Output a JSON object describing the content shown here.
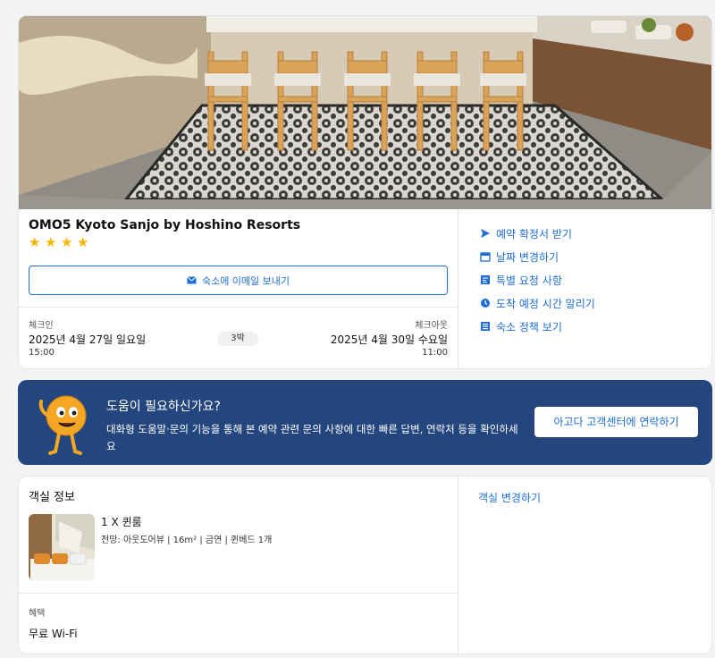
{
  "hotel": {
    "name": "OMO5 Kyoto Sanjo by Hoshino Resorts",
    "rating_stars": 4,
    "email_button": "숙소에 이메일 보내기",
    "checkin": {
      "label": "체크인",
      "date": "2025년 4월 27일 일요일",
      "time": "15:00"
    },
    "nights": "3박",
    "checkout": {
      "label": "체크아웃",
      "date": "2025년 4월 30일 수요일",
      "time": "11:00"
    },
    "actions": [
      {
        "label": "예약 확정서 받기",
        "icon": "send-icon"
      },
      {
        "label": "날짜 변경하기",
        "icon": "calendar-icon"
      },
      {
        "label": "특별 요청 사항",
        "icon": "note-icon"
      },
      {
        "label": "도착 예정 시간 알리기",
        "icon": "clock-icon"
      },
      {
        "label": "숙소 정책 보기",
        "icon": "document-icon"
      }
    ]
  },
  "help": {
    "title": "도움이 필요하신가요?",
    "text": "대화형 도움말·문의 기능을 통해 본 예약 관련 문의 사항에 대한 빠른 답변, 연락처 등을 확인하세요",
    "contact_button": "아고다 고객센터에 연락하기"
  },
  "room": {
    "section_title": "객실 정보",
    "name": "1 X 퀸룸",
    "details": "전망: 아웃도어뷰 | 16m² | 금연 | 퀸베드 1개",
    "benefit_label": "혜택",
    "benefit_value": "무료 Wi-Fi",
    "change_link": "객실 변경하기"
  },
  "colors": {
    "accent": "#1f6ed4",
    "banner": "#24467f",
    "star": "#f7b500"
  }
}
